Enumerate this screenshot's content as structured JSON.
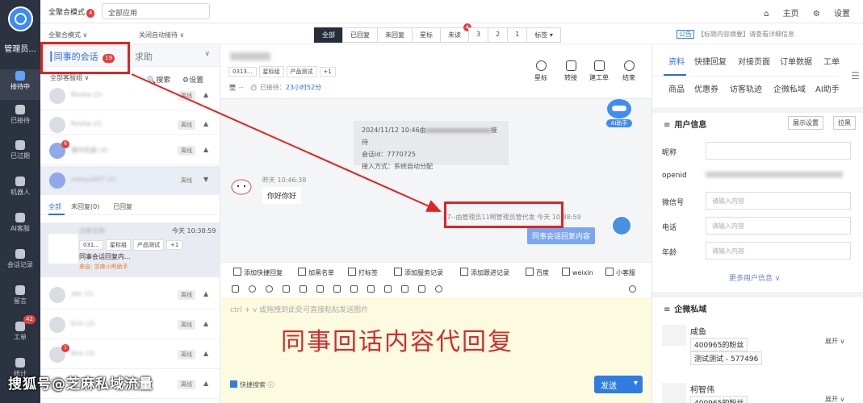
{
  "nav": {
    "user": "管理员...",
    "items": [
      {
        "label": "接待中",
        "active": true
      },
      {
        "label": "已接待"
      },
      {
        "label": "已过期"
      },
      {
        "label": "机器人"
      },
      {
        "label": "AI客服"
      },
      {
        "label": "会话记录"
      },
      {
        "label": "留言"
      },
      {
        "label": "工单",
        "badge": "42"
      },
      {
        "label": "统计"
      }
    ]
  },
  "topbar": {
    "mode": "全聚合模式",
    "mode_badge": "4",
    "app_select": "全部应用",
    "home": "主页",
    "settings": "设置"
  },
  "row2": {
    "agg_mode": "全聚合模式 ∨",
    "auto_accept": "关闭自动接待 ∨",
    "tabs": [
      {
        "label": "全部",
        "on": true
      },
      {
        "label": "已回复"
      },
      {
        "label": "未回复"
      },
      {
        "label": "星标"
      },
      {
        "label": "未读",
        "badge": "4"
      },
      {
        "label": "3"
      },
      {
        "label": "2"
      },
      {
        "label": "1"
      },
      {
        "label": "标签 ▾"
      }
    ],
    "notice_tag": "公告",
    "notice_text": "【标题内容摘要】请查看详细信息"
  },
  "left": {
    "tab_colleague": "同事的会话",
    "tab_colleague_badge": "19",
    "tab_help": "求助",
    "filter": "全部客服组 ∨",
    "search": "搜索",
    "settings": "设置",
    "contacts": [
      {
        "name": "Rosita (2)",
        "status": "离线"
      },
      {
        "name": "爆炸机器 (4)",
        "status": "离线",
        "badge": "6"
      },
      {
        "name": "xianyu007 (1)",
        "status": "离线"
      }
    ],
    "subtabs": {
      "all": "全部",
      "unreplied": "未回复(0)",
      "replied": "已回复"
    },
    "conversation": {
      "name": "访客名称",
      "time": "今天 10:38:59",
      "tags": [
        "031...",
        "星标组",
        "产品测试",
        "+1"
      ],
      "message": "同事会话回复内...",
      "source": "来自: 芝麻小熊助手"
    },
    "contacts2": [
      {
        "name": "abc (1)",
        "status": "离线"
      },
      {
        "name": "Erin (2)",
        "status": "离线"
      },
      {
        "name": "Ann (3)",
        "status": "离线",
        "badge": "1"
      },
      {
        "name": "用户 (1)",
        "status": "离线"
      }
    ]
  },
  "chat": {
    "tags": [
      "0313...",
      "星标组",
      "产品测试",
      "+1"
    ],
    "accepted_label": "已接待：",
    "accepted_time": "23小时52分",
    "actions": [
      "星标",
      "转接",
      "建工单",
      "结束"
    ],
    "ai_label": "AI助手",
    "system": {
      "line1": "2024/11/12 10:46由",
      "line1b": "接待",
      "line2": "会话id：7770725",
      "line3": "接入方式：系统自动分配"
    },
    "incoming": {
      "time": "昨天 10:46:38",
      "text": "你好你好"
    },
    "outgoing": {
      "meta": "...7--由管理员11啊管理员管代发 今天 10:38:59",
      "text": "同事会话回复内容"
    },
    "quick": [
      "添加快捷回复",
      "加黑名单",
      "打标签",
      "添加服务记录",
      "添加跟进记录",
      "百度",
      "weixin",
      "小客服"
    ],
    "placeholder": "ctrl + v 或拖拽到此处可直接粘贴发送图片",
    "overlay_text": "同事回话内容代回复",
    "quick_search": "快捷搜索",
    "send": "发送"
  },
  "right": {
    "tabs1": [
      "资料",
      "快捷回复",
      "对接页面",
      "订单数据",
      "工单"
    ],
    "tabs2": [
      "商品",
      "优惠券",
      "访客轨迹",
      "企微私域",
      "AI助手"
    ],
    "user_info": "用户信息",
    "show_settings": "展示设置",
    "pull": "拉黑",
    "fields": [
      {
        "label": "昵称",
        "value": ""
      },
      {
        "label": "openid",
        "value": ""
      },
      {
        "label": "微信号",
        "placeholder": "请输入内容"
      },
      {
        "label": "电话",
        "placeholder": "请输入内容"
      },
      {
        "label": "年龄",
        "placeholder": "请输入内容"
      }
    ],
    "more": "更多用户信息 ∨",
    "wecom": "企微私域",
    "contacts": [
      {
        "name": "咸鱼",
        "tags": [
          "400965的粉丝",
          "测试测试 - 577496"
        ],
        "expand": "展开"
      },
      {
        "name": "柯智伟",
        "tags": [
          "400965的粉丝"
        ],
        "expand": "展开"
      }
    ]
  },
  "watermark": "搜狐号@芝麻私域流量",
  "colors": {
    "accent": "#2f7de1",
    "nav": "#2b3240",
    "highlight": "#e32222"
  }
}
